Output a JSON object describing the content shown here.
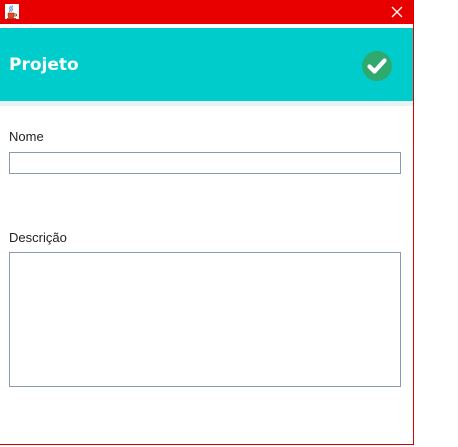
{
  "window": {
    "title": "",
    "colors": {
      "titlebar": "#e80000",
      "header": "#00cccc",
      "confirm_icon": "#2eaa6e"
    },
    "icons": {
      "app": "java-cup-icon",
      "close": "close-icon",
      "confirm": "check-circle-icon"
    }
  },
  "header": {
    "title": "Projeto"
  },
  "form": {
    "nome": {
      "label": "Nome",
      "value": ""
    },
    "descricao": {
      "label": "Descrição",
      "value": ""
    }
  }
}
